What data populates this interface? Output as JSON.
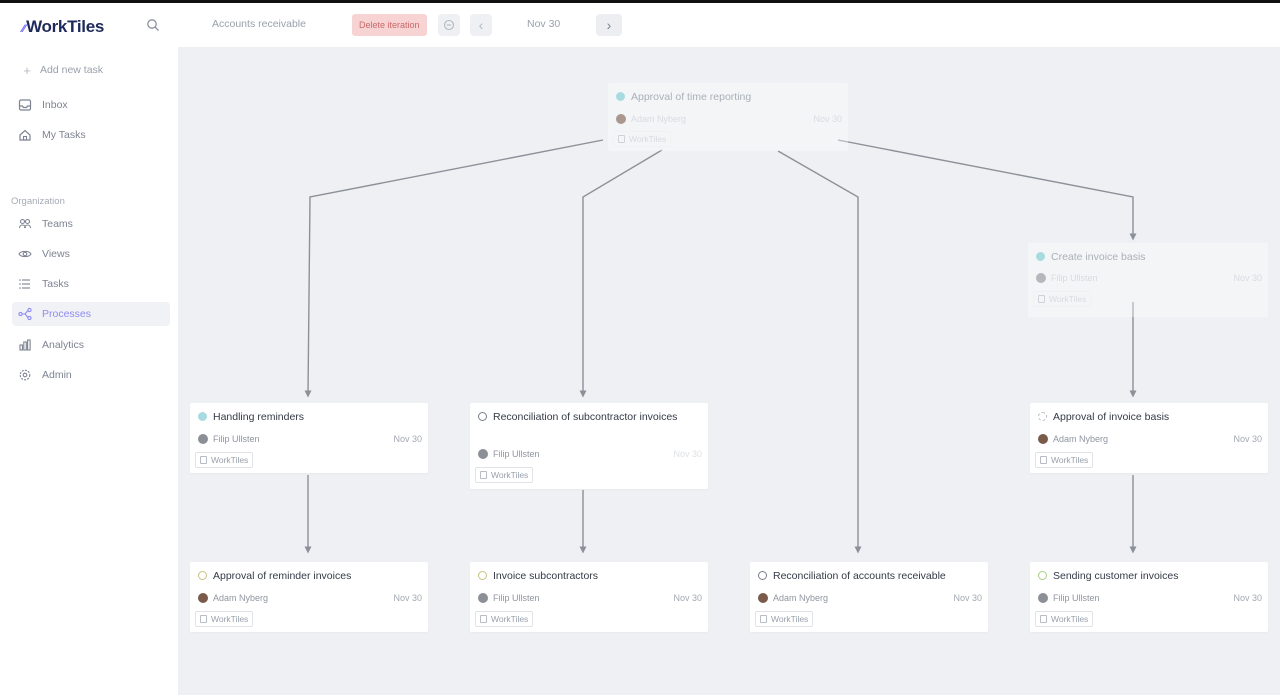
{
  "app": {
    "name": "WorkTiles"
  },
  "sidebar": {
    "add_task": "Add new task",
    "inbox": "Inbox",
    "my_tasks": "My Tasks",
    "section": "Organization",
    "teams": "Teams",
    "views": "Views",
    "tasks": "Tasks",
    "processes": "Processes",
    "analytics": "Analytics",
    "admin": "Admin",
    "active_item": "Processes"
  },
  "topbar": {
    "breadcrumb": "Accounts receivable",
    "delete_label": "Delete iteration",
    "prev": "‹",
    "date": "Nov 30",
    "next": "›"
  },
  "colors": {
    "accent": "#8e8cf2",
    "delete_bg": "#f7d3d3",
    "canvas_bg": "#eef0f3"
  },
  "cards": {
    "approval_time": {
      "title": "Approval of time reporting",
      "assignee": "Adam Nyberg",
      "due": "Nov 30",
      "tag": "WorkTiles",
      "status": "teal"
    },
    "create_basis": {
      "title": "Create invoice basis",
      "assignee": "Filip Ullsten",
      "due": "Nov 30",
      "tag": "WorkTiles",
      "status": "teal"
    },
    "reminders": {
      "title": "Handling reminders",
      "assignee": "Filip Ullsten",
      "due": "Nov 30",
      "tag": "WorkTiles",
      "status": "teal"
    },
    "recon_sub": {
      "title": "Reconciliation of subcontractor invoices",
      "assignee": "Filip Ullsten",
      "due": "Nov 30",
      "tag": "WorkTiles",
      "status": "open"
    },
    "approval_basis": {
      "title": "Approval of invoice basis",
      "assignee": "Adam Nyberg",
      "due": "Nov 30",
      "tag": "WorkTiles",
      "status": "grey"
    },
    "approval_reminder": {
      "title": "Approval of reminder invoices",
      "assignee": "Adam Nyberg",
      "due": "Nov 30",
      "tag": "WorkTiles",
      "status": "gold"
    },
    "invoice_sub": {
      "title": "Invoice subcontractors",
      "assignee": "Filip Ullsten",
      "due": "Nov 30",
      "tag": "WorkTiles",
      "status": "gold"
    },
    "recon_ar": {
      "title": "Reconciliation of accounts receivable",
      "assignee": "Adam Nyberg",
      "due": "Nov 30",
      "tag": "WorkTiles",
      "status": "open"
    },
    "sending": {
      "title": "Sending customer invoices",
      "assignee": "Filip Ullsten",
      "due": "Nov 30",
      "tag": "WorkTiles",
      "status": "lime"
    }
  }
}
